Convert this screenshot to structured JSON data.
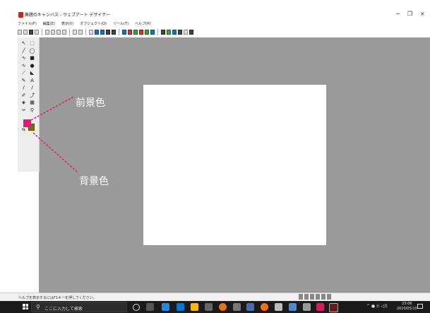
{
  "window": {
    "title": "無題のキャンバス - ウェブアート デザイナー",
    "minimize": "−",
    "restore": "❐",
    "close": "×"
  },
  "menu": [
    {
      "label": "ファイル(F)"
    },
    {
      "label": "編集(E)"
    },
    {
      "label": "表示(V)"
    },
    {
      "label": "オブジェクト(O)"
    },
    {
      "label": "ツール(T)"
    },
    {
      "label": "ヘルプ(H)"
    }
  ],
  "tools": [
    {
      "name": "select-arrow-tool",
      "glyph": "↖"
    },
    {
      "name": "rect-select-tool",
      "glyph": "⬚"
    },
    {
      "name": "line-tool",
      "glyph": "╱"
    },
    {
      "name": "ellipse-tool",
      "glyph": "◯"
    },
    {
      "name": "freehand-tool",
      "glyph": "∿"
    },
    {
      "name": "rectangle-tool",
      "glyph": "■"
    },
    {
      "name": "curve-tool",
      "glyph": "∿"
    },
    {
      "name": "circle-fill-tool",
      "glyph": "●"
    },
    {
      "name": "polyline-tool",
      "glyph": "⟋"
    },
    {
      "name": "shape-tool",
      "glyph": "◣"
    },
    {
      "name": "brush-tool",
      "glyph": "✎"
    },
    {
      "name": "text-tool",
      "glyph": "A"
    },
    {
      "name": "pen-tool",
      "glyph": "∕"
    },
    {
      "name": "eraser-line-tool",
      "glyph": "∕"
    },
    {
      "name": "pencil-tool",
      "glyph": "✐"
    },
    {
      "name": "transform-tool",
      "glyph": "⤴"
    },
    {
      "name": "fill-tool",
      "glyph": "◈"
    },
    {
      "name": "pattern-tool",
      "glyph": "▦"
    },
    {
      "name": "eyedropper-tool",
      "glyph": "✑"
    },
    {
      "name": "zoom-tool",
      "glyph": "⚲"
    }
  ],
  "colors": {
    "foreground": "#e6187a",
    "background": "#7a6a10",
    "canvas_area": "#9a9a9a",
    "leader_line": "#e6187a"
  },
  "callouts": {
    "foreground_label": "前景色",
    "background_label": "背景色"
  },
  "status": {
    "help_text": "ヘルプを表示するにはF1キーを押してください。"
  },
  "taskbar": {
    "search_placeholder": "ここに入力して検索",
    "tray_text": "^ ● 🗈 ◁))",
    "time": "23:06",
    "date": "2020/05/10"
  }
}
